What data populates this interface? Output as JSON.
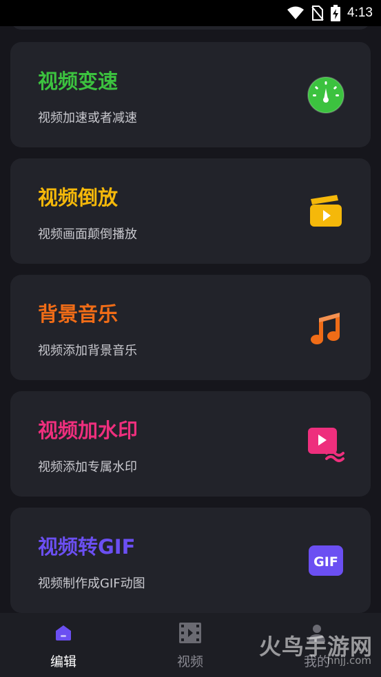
{
  "status_bar": {
    "time": "4:13"
  },
  "cards": [
    {
      "title": "视频变速",
      "subtitle": "视频加速或者减速",
      "color": "#3cc23f",
      "icon": "speedometer-icon"
    },
    {
      "title": "视频倒放",
      "subtitle": "视频画面颠倒播放",
      "color": "#f5b80a",
      "icon": "reverse-play-icon"
    },
    {
      "title": "背景音乐",
      "subtitle": "视频添加背景音乐",
      "color": "#f06c17",
      "icon": "music-note-icon"
    },
    {
      "title": "视频加水印",
      "subtitle": "视频添加专属水印",
      "color": "#ee2f7d",
      "icon": "video-watermark-icon"
    },
    {
      "title": "视频转GIF",
      "subtitle": "视频制作成GIF动图",
      "color": "#6b4ff2",
      "icon": "gif-icon",
      "icon_text": "GIF"
    }
  ],
  "bottom_nav": {
    "items": [
      {
        "label": "编辑",
        "active": true,
        "color": "#ffffff"
      },
      {
        "label": "视频",
        "active": false,
        "color": "#8a8a92"
      },
      {
        "label": "我的",
        "active": false,
        "color": "#8a8a92"
      }
    ]
  },
  "watermark": {
    "text": "火鸟手游网",
    "sub": "hnjj.com"
  },
  "colors": {
    "background": "#16161c",
    "card": "#22232a",
    "accent": "#6b4ff2"
  }
}
